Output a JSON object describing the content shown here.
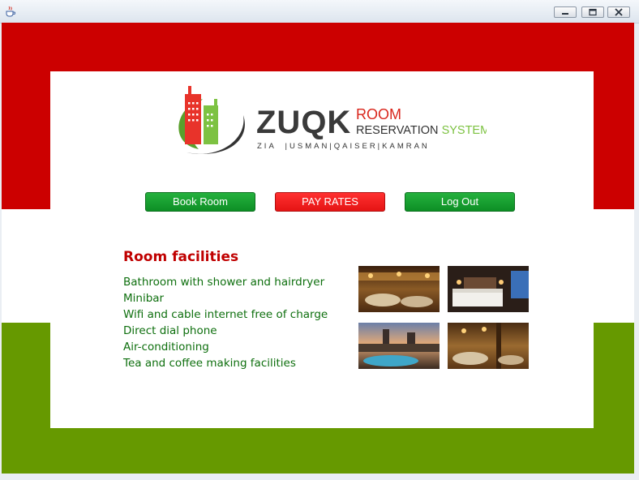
{
  "window": {
    "icons": {
      "app": "java-cup-icon",
      "minimize": "minimize-icon",
      "maximize": "maximize-icon",
      "close": "close-icon"
    }
  },
  "logo": {
    "brand": "ZUQK",
    "line1": "ROOM",
    "line2a": "RESERVATION",
    "line2b": "SYSTEM",
    "tagline": "ZIA  |USMAN|QAISER|KAMRAN"
  },
  "actions": {
    "book_room": "Book Room",
    "pay_rates": "PAY RATES",
    "log_out": "Log Out"
  },
  "facilities": {
    "title": "Room facilities",
    "items": [
      "Bathroom with shower and hairdryer",
      "Minibar",
      "Wifi and cable internet free of charge",
      "Direct dial phone",
      "Air-conditioning",
      "Tea and coffee making facilities"
    ]
  },
  "colors": {
    "top_band": "#cc0000",
    "bottom_band": "#669900",
    "title_red": "#c00000",
    "list_green": "#0e6f0e",
    "button_green": "#139a2e",
    "button_red": "#f21f1f"
  }
}
